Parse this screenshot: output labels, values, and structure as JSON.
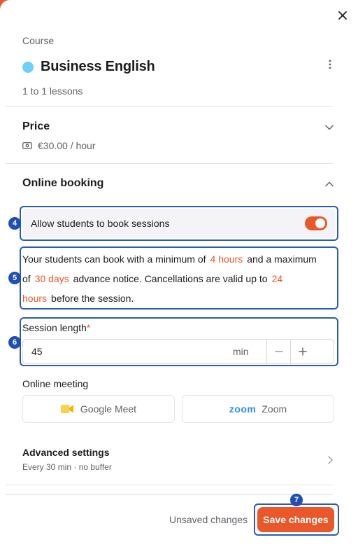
{
  "course": {
    "label": "Course",
    "name": "Business English",
    "dot_color": "#6fd0f5",
    "subtitle": "1 to 1 lessons"
  },
  "price": {
    "title": "Price",
    "value": "€30.00 / hour"
  },
  "online_booking": {
    "title": "Online booking",
    "allow_label": "Allow students to book sessions",
    "allow_enabled": true,
    "notice": {
      "part1": "Your students can book with a minimum of",
      "min_notice": "4 hours",
      "part2": "and a maximum of",
      "max_notice": "30 days",
      "part3": "advance notice. Cancellations are valid up to",
      "cancel_window": "24 hours",
      "part4": "before the session."
    },
    "session_length": {
      "label": "Session length",
      "required_mark": "*",
      "value": "45",
      "unit": "min",
      "decrement": "−",
      "increment": "+"
    },
    "online_meeting": {
      "label": "Online meeting",
      "options": [
        {
          "label": "Google Meet",
          "icon": "google-meet-icon"
        },
        {
          "label": "Zoom",
          "logo": "zoom",
          "icon": "zoom-icon"
        }
      ]
    }
  },
  "advanced": {
    "title": "Advanced settings",
    "summary": "Every 30 min · no buffer"
  },
  "footer": {
    "status": "Unsaved changes",
    "save_label": "Save changes"
  },
  "annotations": [
    "4",
    "5",
    "6",
    "7"
  ],
  "colors": {
    "accent": "#e8582a",
    "annotation": "#2a5db0"
  }
}
